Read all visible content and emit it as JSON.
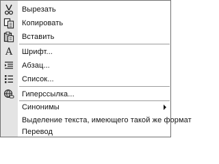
{
  "menu": {
    "items": [
      {
        "label": "Вырезать",
        "icon": "scissors-icon"
      },
      {
        "label": "Копировать",
        "icon": "copy-icon"
      },
      {
        "label": "Вставить",
        "icon": "paste-icon"
      },
      {
        "label": "Шрифт...",
        "icon": "font-icon"
      },
      {
        "label": "Абзац...",
        "icon": "paragraph-icon"
      },
      {
        "label": "Список...",
        "icon": "list-icon"
      },
      {
        "label": "Гиперссылка...",
        "icon": "hyperlink-icon"
      },
      {
        "label": "Синонимы",
        "icon": ""
      },
      {
        "label": "Выделение текста, имеющего такой же формат",
        "icon": ""
      },
      {
        "label": "Перевод",
        "icon": ""
      }
    ]
  }
}
